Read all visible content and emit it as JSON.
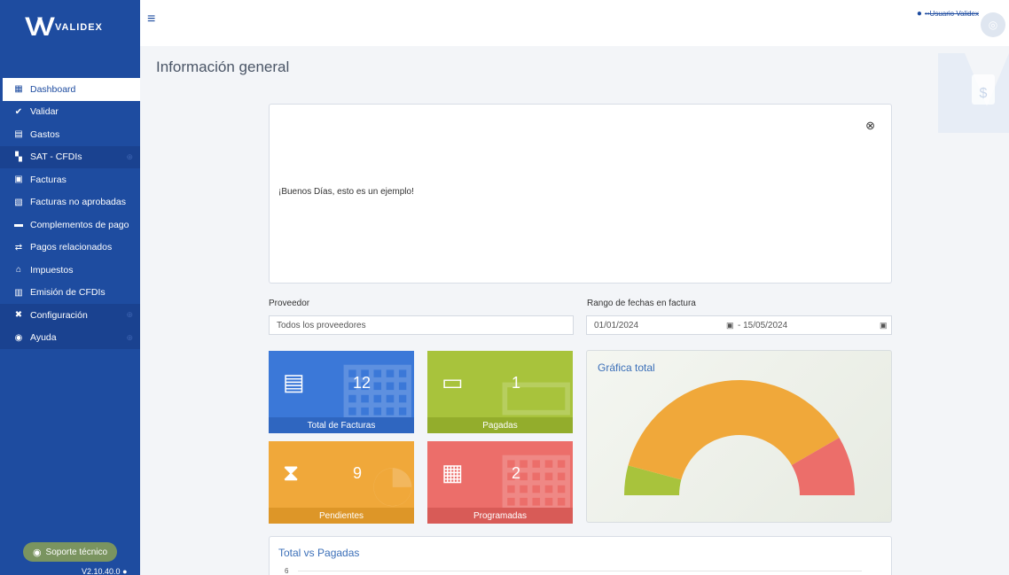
{
  "app": {
    "brand": "VALIDEX",
    "version": "V2.10.40.0"
  },
  "header": {
    "user_name": "••Usuario Validex"
  },
  "sidebar": {
    "items": [
      {
        "label": "Dashboard",
        "icon": "grid-icon"
      },
      {
        "label": "Validar",
        "icon": "check-icon"
      },
      {
        "label": "Gastos",
        "icon": "receipt-icon"
      },
      {
        "label": "SAT - CFDIs",
        "icon": "sat-icon"
      },
      {
        "label": "Facturas",
        "icon": "invoice-icon"
      },
      {
        "label": "Facturas no aprobadas",
        "icon": "invoice-rejected-icon"
      },
      {
        "label": "Complementos de pago",
        "icon": "document-icon"
      },
      {
        "label": "Pagos relacionados",
        "icon": "exchange-icon"
      },
      {
        "label": "Impuestos",
        "icon": "bank-icon"
      },
      {
        "label": "Emisión de CFDIs",
        "icon": "emission-icon"
      },
      {
        "label": "Configuración",
        "icon": "tools-icon"
      },
      {
        "label": "Ayuda",
        "icon": "help-icon"
      }
    ],
    "support_label": "Soporte técnico"
  },
  "main": {
    "title": "Información general",
    "message": "¡Buenos Días, esto es un ejemplo!",
    "filters": {
      "provider_label": "Proveedor",
      "provider_value": "Todos los proveedores",
      "date_label": "Rango de fechas en factura",
      "date_from": "01/01/2024",
      "date_to": "- 15/05/2024"
    },
    "tiles": {
      "facturas": {
        "value": "12",
        "label": "Total de Facturas"
      },
      "pagadas": {
        "value": "1",
        "label": "Pagadas"
      },
      "pendientes": {
        "value": "9",
        "label": "Pendientes"
      },
      "programadas": {
        "value": "2",
        "label": "Programadas"
      }
    },
    "gauge_title": "Gráfica total",
    "bottom_title": "Total vs Pagadas",
    "bottom_axis_top": "6"
  },
  "colors": {
    "sidebar": "#1e4ca0",
    "facturas": "#3b78d8",
    "pagadas": "#a8c33c",
    "pendientes": "#f0a83a",
    "programadas": "#ec6e6a"
  },
  "chart_data": {
    "type": "pie",
    "variant": "semi-donut",
    "title": "Gráfica total",
    "categories": [
      "Pagadas",
      "Pendientes",
      "Programadas"
    ],
    "values": [
      1,
      9,
      2
    ],
    "colors": [
      "#a8c33c",
      "#f0a83a",
      "#ec6e6a"
    ]
  }
}
